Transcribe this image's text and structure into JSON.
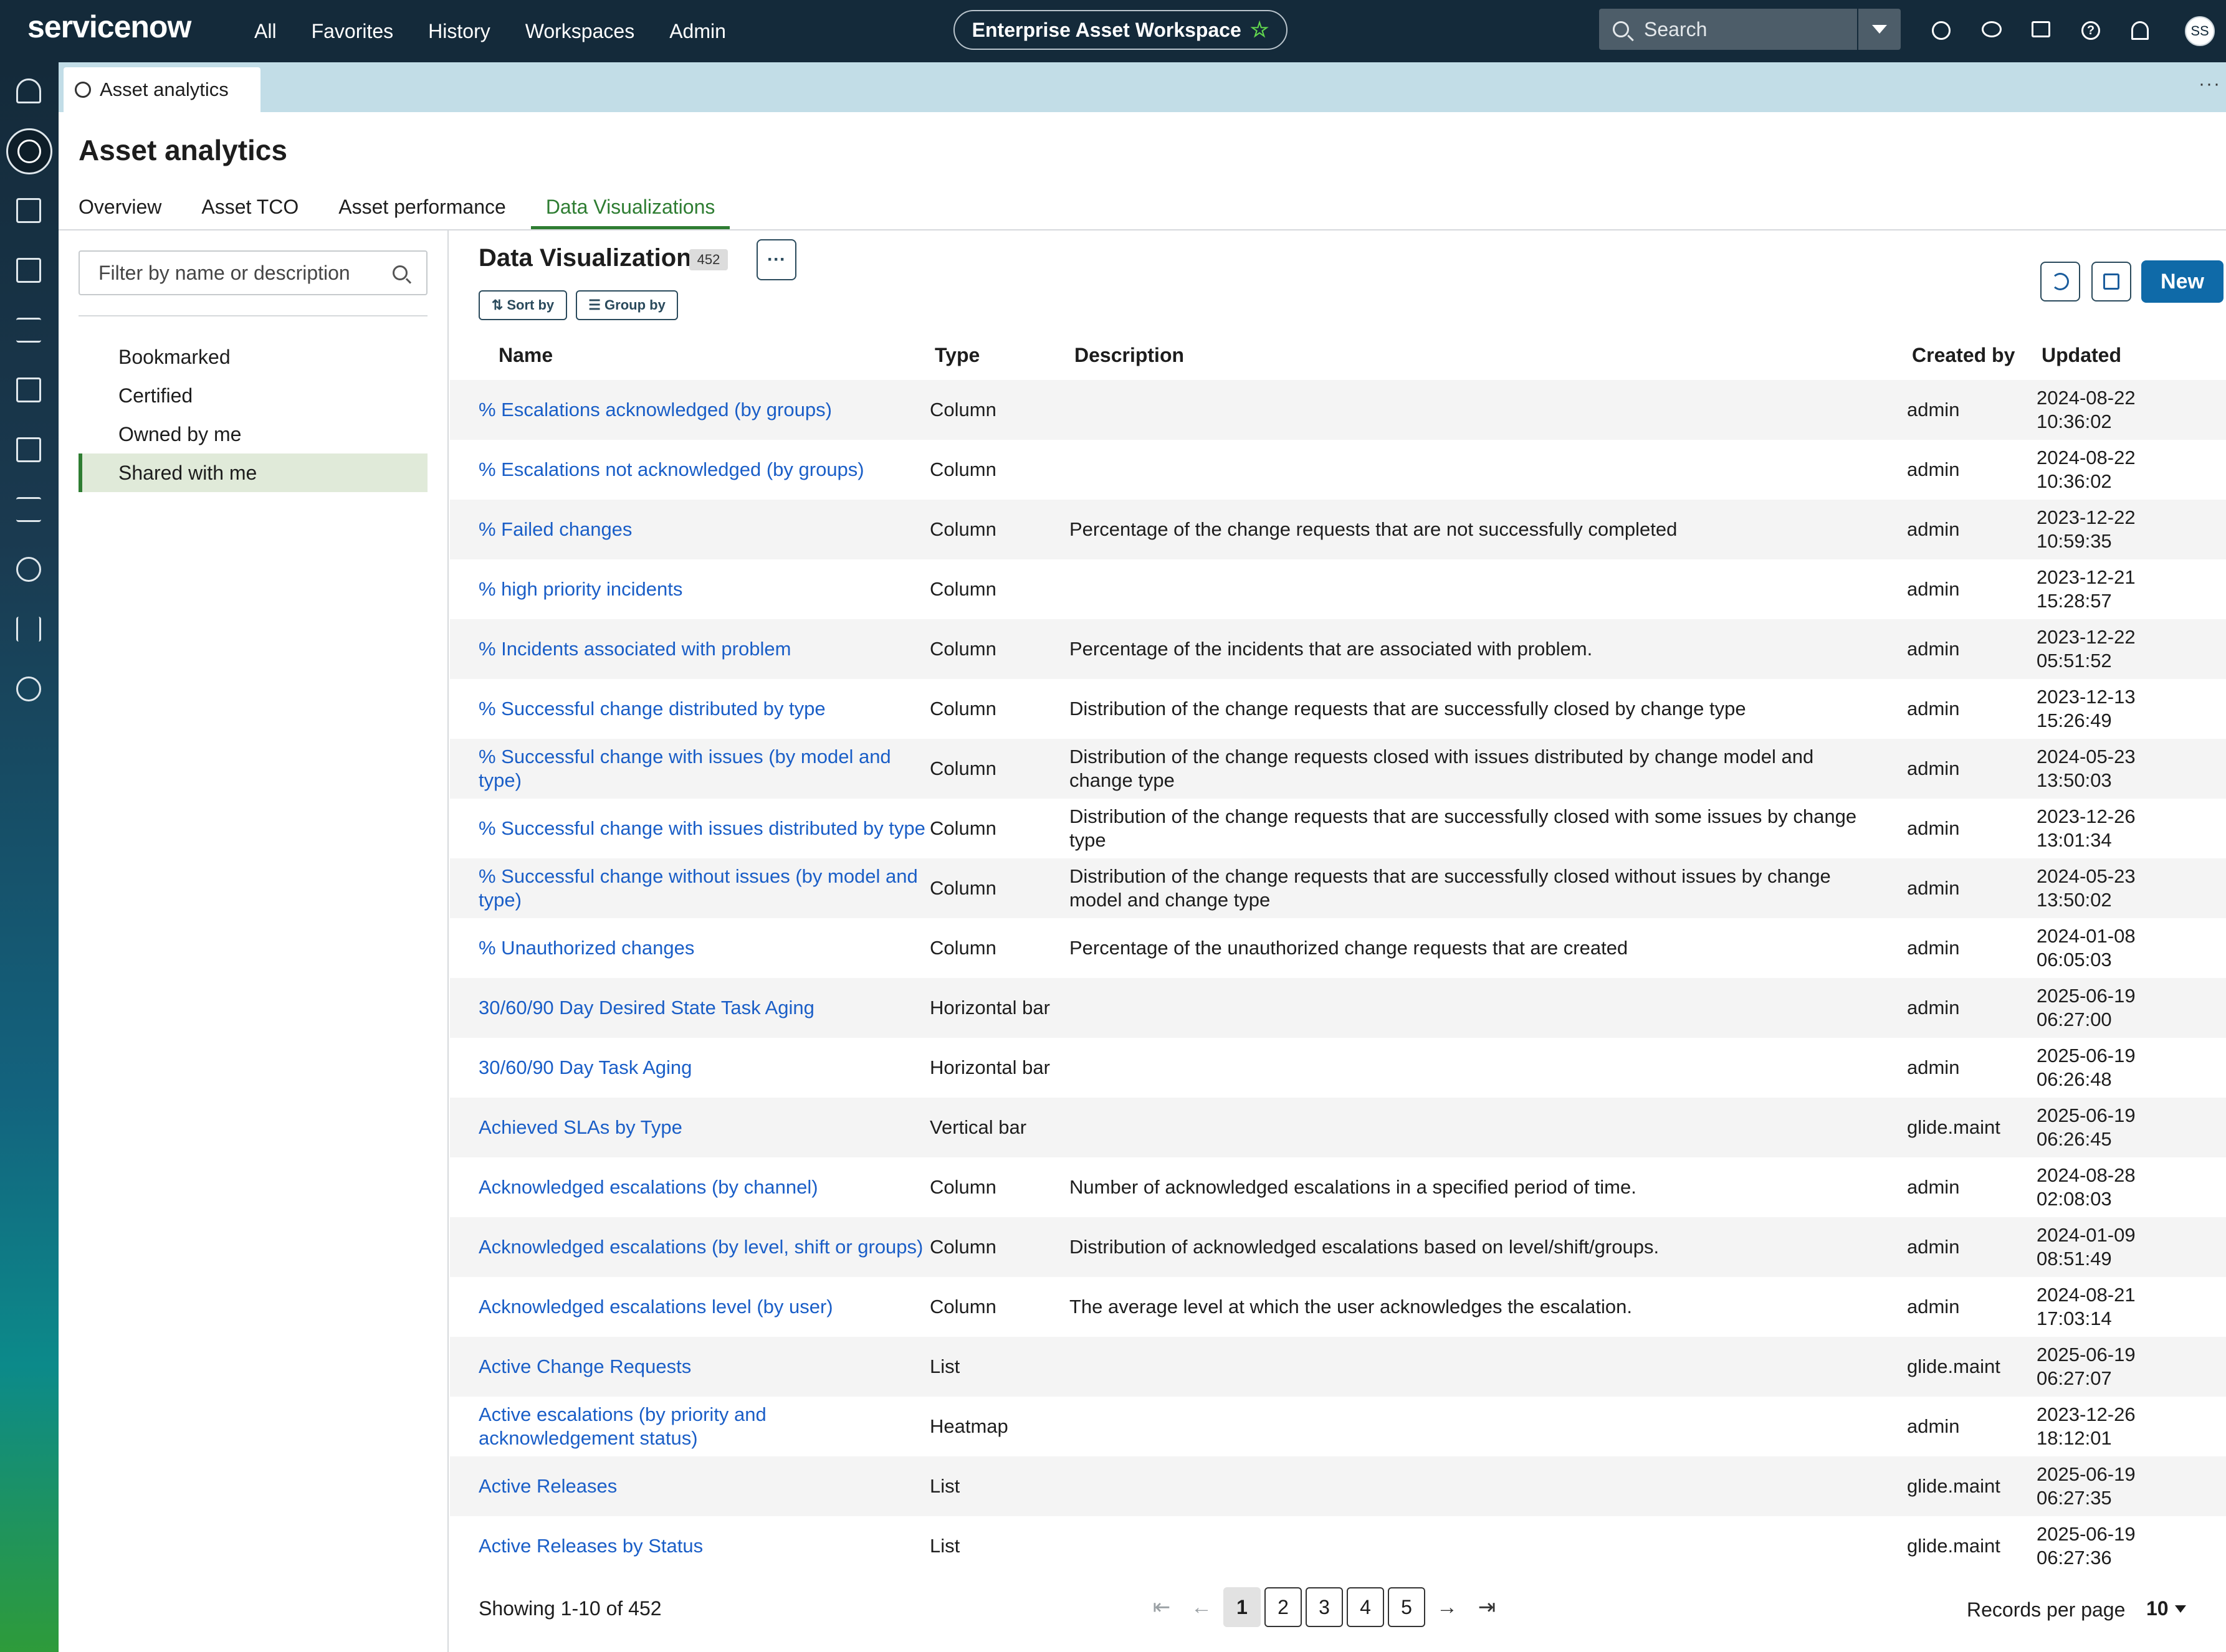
{
  "topbar": {
    "logo": "servicenow",
    "nav": [
      "All",
      "Favorites",
      "History",
      "Workspaces",
      "Admin"
    ],
    "workspace": "Enterprise Asset Workspace",
    "search_placeholder": "Search",
    "avatar_initials": "SS"
  },
  "tab": {
    "label": "Asset analytics"
  },
  "page": {
    "title": "Asset analytics",
    "subtabs": [
      "Overview",
      "Asset TCO",
      "Asset performance",
      "Data Visualizations"
    ]
  },
  "filter": {
    "placeholder": "Filter by name or description",
    "items": [
      "Bookmarked",
      "Certified",
      "Owned by me",
      "Shared with me"
    ]
  },
  "list": {
    "title": "Data Visualizations",
    "count": "452",
    "more_label": "···",
    "sort_label": "Sort by",
    "group_label": "Group by",
    "new_label": "New"
  },
  "table": {
    "headers": {
      "name": "Name",
      "type": "Type",
      "description": "Description",
      "created_by": "Created by",
      "updated": "Updated"
    },
    "rows": [
      {
        "name": "% Escalations acknowledged (by groups)",
        "type": "Column",
        "description": "",
        "created_by": "admin",
        "updated_date": "2024-08-22",
        "updated_time": "10:36:02"
      },
      {
        "name": "% Escalations not acknowledged (by groups)",
        "type": "Column",
        "description": "",
        "created_by": "admin",
        "updated_date": "2024-08-22",
        "updated_time": "10:36:02"
      },
      {
        "name": "% Failed changes",
        "type": "Column",
        "description": "Percentage of the change requests that are not successfully completed",
        "created_by": "admin",
        "updated_date": "2023-12-22",
        "updated_time": "10:59:35"
      },
      {
        "name": "% high priority incidents",
        "type": "Column",
        "description": "",
        "created_by": "admin",
        "updated_date": "2023-12-21",
        "updated_time": "15:28:57"
      },
      {
        "name": "% Incidents associated with problem",
        "type": "Column",
        "description": "Percentage of the incidents that are associated with problem.",
        "created_by": "admin",
        "updated_date": "2023-12-22",
        "updated_time": "05:51:52"
      },
      {
        "name": "% Successful change distributed by type",
        "type": "Column",
        "description": "Distribution of the change requests that are successfully closed by change type",
        "created_by": "admin",
        "updated_date": "2023-12-13",
        "updated_time": "15:26:49"
      },
      {
        "name": "% Successful change with issues (by model and type)",
        "type": "Column",
        "description": "Distribution of the change requests closed with issues distributed by change model and change type",
        "created_by": "admin",
        "updated_date": "2024-05-23",
        "updated_time": "13:50:03"
      },
      {
        "name": "% Successful change with issues distributed by type",
        "type": "Column",
        "description": "Distribution of the change requests that are successfully closed with some issues by change type",
        "created_by": "admin",
        "updated_date": "2023-12-26",
        "updated_time": "13:01:34"
      },
      {
        "name": "% Successful change without issues (by model and type)",
        "type": "Column",
        "description": "Distribution of the change requests that are successfully closed without issues by change model and change type",
        "created_by": "admin",
        "updated_date": "2024-05-23",
        "updated_time": "13:50:02"
      },
      {
        "name": "% Unauthorized changes",
        "type": "Column",
        "description": "Percentage of the unauthorized change requests that are created",
        "created_by": "admin",
        "updated_date": "2024-01-08",
        "updated_time": "06:05:03"
      },
      {
        "name": "30/60/90 Day Desired State Task Aging",
        "type": "Horizontal bar",
        "description": "",
        "created_by": "admin",
        "updated_date": "2025-06-19",
        "updated_time": "06:27:00"
      },
      {
        "name": "30/60/90 Day Task Aging",
        "type": "Horizontal bar",
        "description": "",
        "created_by": "admin",
        "updated_date": "2025-06-19",
        "updated_time": "06:26:48"
      },
      {
        "name": "Achieved SLAs by Type",
        "type": "Vertical bar",
        "description": "",
        "created_by": "glide.maint",
        "updated_date": "2025-06-19",
        "updated_time": "06:26:45"
      },
      {
        "name": "Acknowledged escalations (by channel)",
        "type": "Column",
        "description": "Number of acknowledged escalations in a specified period of time.",
        "created_by": "admin",
        "updated_date": "2024-08-28",
        "updated_time": "02:08:03"
      },
      {
        "name": "Acknowledged escalations (by level, shift or groups)",
        "type": "Column",
        "description": "Distribution of acknowledged escalations based on level/shift/groups.",
        "created_by": "admin",
        "updated_date": "2024-01-09",
        "updated_time": "08:51:49"
      },
      {
        "name": "Acknowledged escalations level (by user)",
        "type": "Column",
        "description": "The average level at which the user acknowledges the escalation.",
        "created_by": "admin",
        "updated_date": "2024-08-21",
        "updated_time": "17:03:14"
      },
      {
        "name": "Active Change Requests",
        "type": "List",
        "description": "",
        "created_by": "glide.maint",
        "updated_date": "2025-06-19",
        "updated_time": "06:27:07"
      },
      {
        "name": "Active escalations (by priority and acknowledgement status)",
        "type": "Heatmap",
        "description": "",
        "created_by": "admin",
        "updated_date": "2023-12-26",
        "updated_time": "18:12:01"
      },
      {
        "name": "Active Releases",
        "type": "List",
        "description": "",
        "created_by": "glide.maint",
        "updated_date": "2025-06-19",
        "updated_time": "06:27:35"
      },
      {
        "name": "Active Releases by Status",
        "type": "List",
        "description": "",
        "created_by": "glide.maint",
        "updated_date": "2025-06-19",
        "updated_time": "06:27:36"
      }
    ]
  },
  "footer": {
    "showing": "Showing 1-10 of 452",
    "pages": [
      "1",
      "2",
      "3",
      "4",
      "5"
    ],
    "current_page": "1",
    "records_label": "Records per page",
    "records_value": "10"
  },
  "colors": {
    "topbar": "#142a3a",
    "accent_green": "#2e7d32",
    "link": "#1a5ec7",
    "primary_button": "#0f6aa8"
  }
}
